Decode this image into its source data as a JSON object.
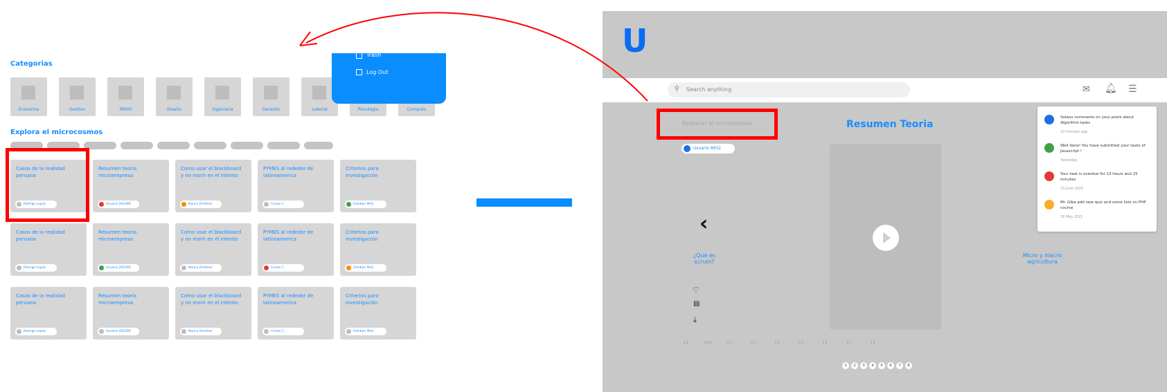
{
  "left": {
    "categorias_title": "Categorias",
    "categories": [
      "Economia",
      "Gestion",
      "RRHH",
      "Diseño",
      "Ingenieria",
      "Derecho",
      "Laboral",
      "Psicologia",
      "Computo"
    ],
    "explora_title": "Explora el microcosmos",
    "filter_chips": [
      "",
      "",
      "",
      "",
      "",
      "",
      "",
      "",
      ""
    ],
    "menu": {
      "item1": "Trash",
      "item2": "Log Out"
    },
    "cards": [
      {
        "title": "Casos de la realidad peruana",
        "user": "Rodrigo Lopez",
        "color": "#bdbdbd"
      },
      {
        "title": "Resumen teoria microempresa",
        "user": "Usuario 201066",
        "color": "#e53935"
      },
      {
        "title": "Como usar el blackboard y no morir en el intento",
        "user": "Nancy Ordoñez",
        "color": "#fb8c00"
      },
      {
        "title": "PYMES al rededor de latinoamerica",
        "user": "Carlos C.",
        "color": "#bdbdbd"
      },
      {
        "title": "Criterios para investigación",
        "user": "Esteban Miró",
        "color": "#43a047"
      },
      {
        "title": "Casos de la realidad peruana",
        "user": "Rodrigo Lopez",
        "color": "#bdbdbd"
      },
      {
        "title": "Resumen teoria microempresa",
        "user": "Usuario 201066",
        "color": "#43a047"
      },
      {
        "title": "Como usar el blackboard y no morir en el intento",
        "user": "Nancy Ordoñez",
        "color": "#bdbdbd"
      },
      {
        "title": "PYMES al rededor de latinoamerica",
        "user": "Carlos C.",
        "color": "#e53935"
      },
      {
        "title": "Criterios para investigación",
        "user": "Esteban Miró",
        "color": "#fb8c00"
      },
      {
        "title": "Casos de la realidad peruana",
        "user": "Rodrigo Lopez",
        "color": "#bdbdbd"
      },
      {
        "title": "Resumen teoria microempresa",
        "user": "Usuario 201066",
        "color": "#bdbdbd"
      },
      {
        "title": "Como usar el blackboard y no morir en el intento",
        "user": "Nancy Ordoñez",
        "color": "#bdbdbd"
      },
      {
        "title": "PYMES al rededor de latinoamerica",
        "user": "Carlos C.",
        "color": "#bdbdbd"
      },
      {
        "title": "Criterios para investigación",
        "user": "Esteban Miró",
        "color": "#bdbdbd"
      }
    ]
  },
  "right": {
    "logo": "U",
    "search_placeholder": "Search anything",
    "back_link": "Regresar al microcosmos",
    "title": "Resumen Teoria",
    "user_chip": "Usuario 8952",
    "prev_label": "¿Que es scrum?",
    "next_label": "Micro y macro agricultura",
    "ruler_text": "·  25  ·  ·  ·  ·  100  ·  ·  ·  ·  25  ·  ·  ·  ·  ·  25  ·  ·  ·  ·  ·  25  ·  ·  ·  ·  ·  25  ·  ·  ·  ·  ·  25  ·  ·  ·  ·  ·  25  ·  ·  ·  ·  ·  25",
    "pages": [
      "1",
      "2",
      "3",
      "4",
      "5",
      "6",
      "7",
      "8"
    ],
    "notifications": [
      {
        "text": "Solanx comments on your posts about Algorithm tasks",
        "date": "20 minutes ago",
        "color": "#1e6fe6"
      },
      {
        "text": "Well done! You have submitted your tasks of Javascript !",
        "date": "Yesterday",
        "color": "#43a047"
      },
      {
        "text": "Your task is overdue for 13 hours and 25 minutes",
        "date": "23 June 2021",
        "color": "#e53935"
      },
      {
        "text": "Mr. Giba add new quiz and some lists on PHP course",
        "date": "28 May 2021",
        "color": "#fbab2b"
      }
    ]
  },
  "colors": {
    "accent": "#1a8cff",
    "highlight": "#ff0000",
    "menu_blue": "#0a8dff"
  }
}
